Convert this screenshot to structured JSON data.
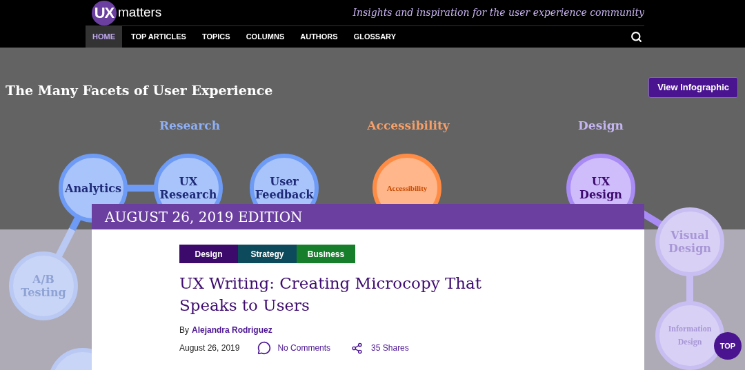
{
  "header": {
    "logo_mark": "UX",
    "logo_text": "matters",
    "tagline": "Insights and inspiration for the user experience community"
  },
  "nav": {
    "items": [
      {
        "label": "HOME",
        "selected": true
      },
      {
        "label": "TOP ARTICLES",
        "selected": false
      },
      {
        "label": "TOPICS",
        "selected": false
      },
      {
        "label": "COLUMNS",
        "selected": false
      },
      {
        "label": "AUTHORS",
        "selected": false
      },
      {
        "label": "GLOSSARY",
        "selected": false
      }
    ]
  },
  "hero": {
    "title": "The Many Facets of User Experience",
    "button": "View Infographic",
    "categories": [
      {
        "label": "Research",
        "color": "#8fb0f5"
      },
      {
        "label": "Accessibility",
        "color": "#f5a06a"
      },
      {
        "label": "Design",
        "color": "#c5b6f2"
      }
    ],
    "nodes": [
      {
        "label": "Analytics",
        "kind": "research"
      },
      {
        "label": "UX Research",
        "kind": "research"
      },
      {
        "label": "User Feedback",
        "kind": "research"
      },
      {
        "label": "Accessibility",
        "kind": "accessibility"
      },
      {
        "label": "UX Design",
        "kind": "design"
      },
      {
        "label": "Visual Design",
        "kind": "design"
      },
      {
        "label": "A/B Testing",
        "kind": "research"
      },
      {
        "label": "Information Design",
        "kind": "design"
      }
    ]
  },
  "edition": "AUGUST 26, 2019 EDITION",
  "article": {
    "tags": [
      {
        "label": "Design",
        "color": "#3b0a6b"
      },
      {
        "label": "Strategy",
        "color": "#0d4b5c"
      },
      {
        "label": "Business",
        "color": "#177f2c"
      }
    ],
    "title": "UX Writing: Creating Microcopy That Speaks to Users",
    "byline": "By",
    "author": "Alejandra Rodriguez",
    "date": "August 26, 2019",
    "comments": "No Comments",
    "shares": "35 Shares"
  },
  "top_button": "TOP"
}
